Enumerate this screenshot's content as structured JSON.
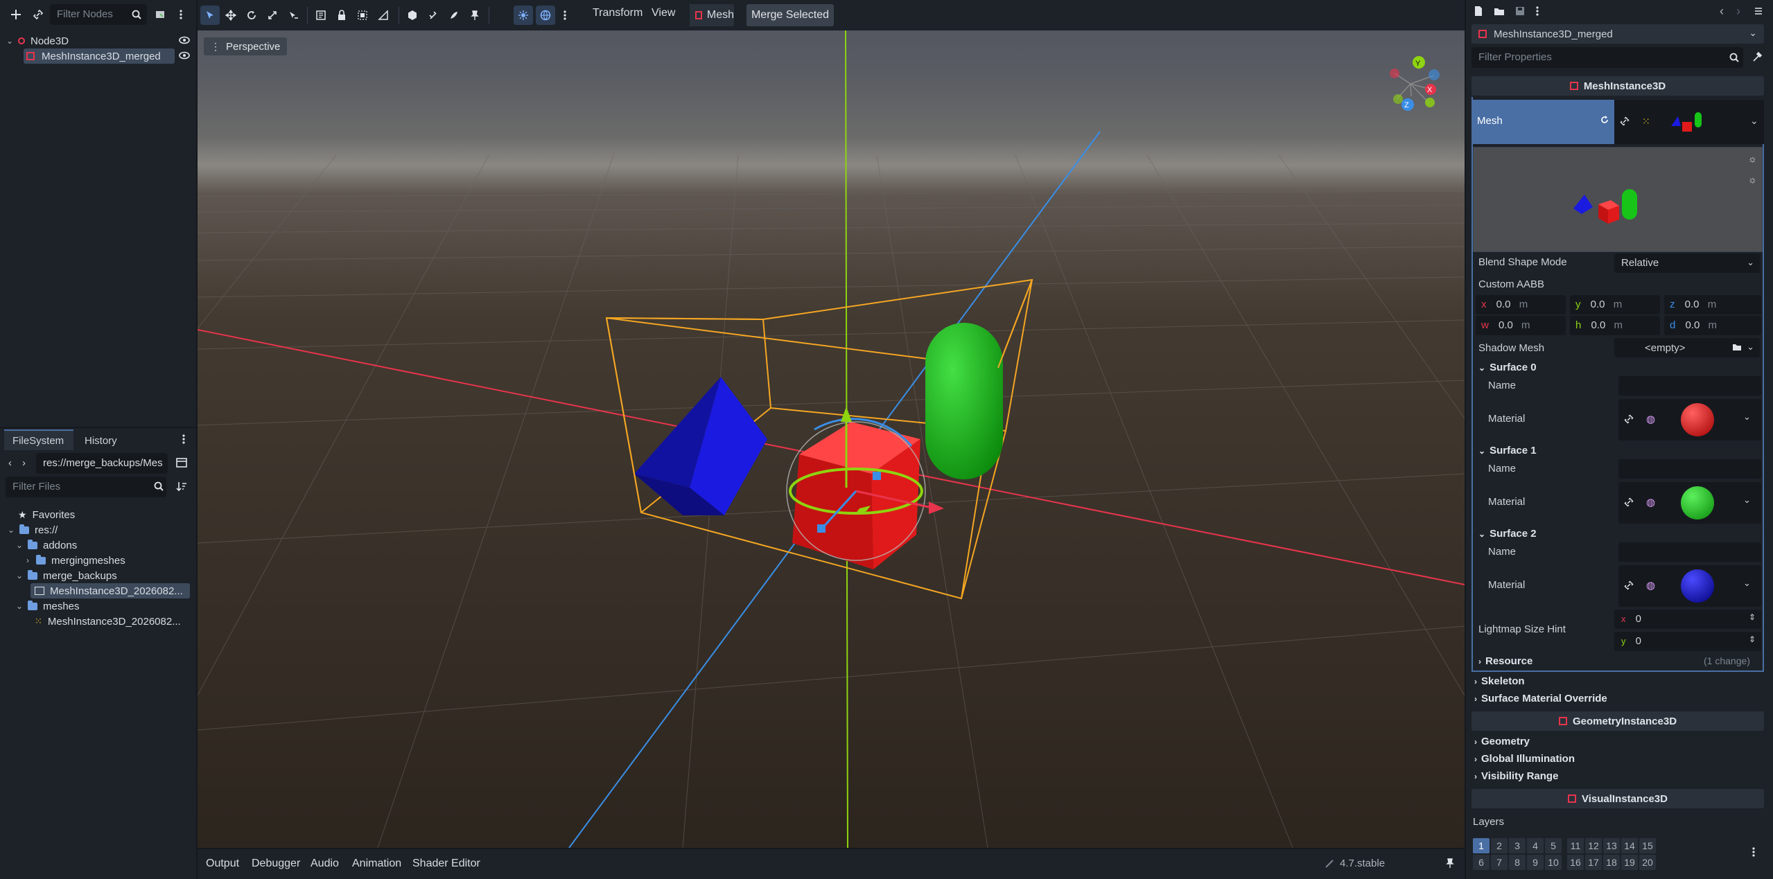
{
  "scene": {
    "filter_placeholder": "Filter Nodes",
    "nodes": [
      {
        "label": "Node3D"
      },
      {
        "label": "MeshInstance3D_merged"
      }
    ]
  },
  "filesystem": {
    "tabs": [
      "FileSystem",
      "History"
    ],
    "path": "res://merge_backups/Mes",
    "filter_placeholder": "Filter Files",
    "items": [
      {
        "label": "Favorites"
      },
      {
        "label": "res://"
      },
      {
        "label": "addons"
      },
      {
        "label": "mergingmeshes"
      },
      {
        "label": "merge_backups"
      },
      {
        "label": "MeshInstance3D_2026082..."
      },
      {
        "label": "meshes"
      },
      {
        "label": "MeshInstance3D_2026082..."
      }
    ]
  },
  "toolbar": {
    "menus": [
      "Transform",
      "View"
    ],
    "mesh_label": "Mesh",
    "merge_label": "Merge Selected"
  },
  "viewport": {
    "perspective_label": "Perspective",
    "gizmo": {
      "y": "Y",
      "z": "Z",
      "x": "X"
    }
  },
  "bottom": {
    "tabs": [
      "Output",
      "Debugger",
      "Audio",
      "Animation",
      "Shader Editor"
    ],
    "version": "4.7.stable"
  },
  "inspector": {
    "object_name": "MeshInstance3D_merged",
    "filter_placeholder": "Filter Properties",
    "class_header": "MeshInstance3D",
    "mesh_label": "Mesh",
    "blend_shape_mode": {
      "label": "Blend Shape Mode",
      "value": "Relative"
    },
    "custom_aabb": {
      "label": "Custom AABB",
      "x": "0.0",
      "y": "0.0",
      "z": "0.0",
      "w": "0.0",
      "h": "0.0",
      "d": "0.0",
      "unit": "m",
      "axis_x": "x",
      "axis_y": "y",
      "axis_z": "z",
      "axis_w": "w",
      "axis_h": "h",
      "axis_d": "d"
    },
    "shadow_mesh": {
      "label": "Shadow Mesh",
      "value": "<empty>"
    },
    "surfaces": [
      {
        "title": "Surface 0",
        "name_label": "Name",
        "material_label": "Material",
        "color": "#e01515"
      },
      {
        "title": "Surface 1",
        "name_label": "Name",
        "material_label": "Material",
        "color": "#17c417"
      },
      {
        "title": "Surface 2",
        "name_label": "Name",
        "material_label": "Material",
        "color": "#1414d8"
      }
    ],
    "lightmap": {
      "label": "Lightmap Size Hint",
      "x_label": "x",
      "x": "0",
      "y_label": "y",
      "y": "0"
    },
    "resource": {
      "label": "Resource",
      "changes": "(1 change)"
    },
    "skeleton": "Skeleton",
    "surface_override": "Surface Material Override",
    "geometry_header": "GeometryInstance3D",
    "geometry": "Geometry",
    "gi": "Global Illumination",
    "visibility": "Visibility Range",
    "visual_header": "VisualInstance3D",
    "layers_label": "Layers",
    "layers_row1": [
      "1",
      "2",
      "3",
      "4",
      "5",
      "11",
      "12",
      "13",
      "14",
      "15"
    ],
    "layers_row2": [
      "6",
      "7",
      "8",
      "9",
      "10",
      "16",
      "17",
      "18",
      "19",
      "20"
    ]
  },
  "colors": {
    "accent": "#4a6fa5",
    "selection": "#3d4a5c",
    "aabb": "#f5a623",
    "axis_x": "#e8344c",
    "axis_y": "#8fd410",
    "axis_z": "#3a8ee6"
  }
}
